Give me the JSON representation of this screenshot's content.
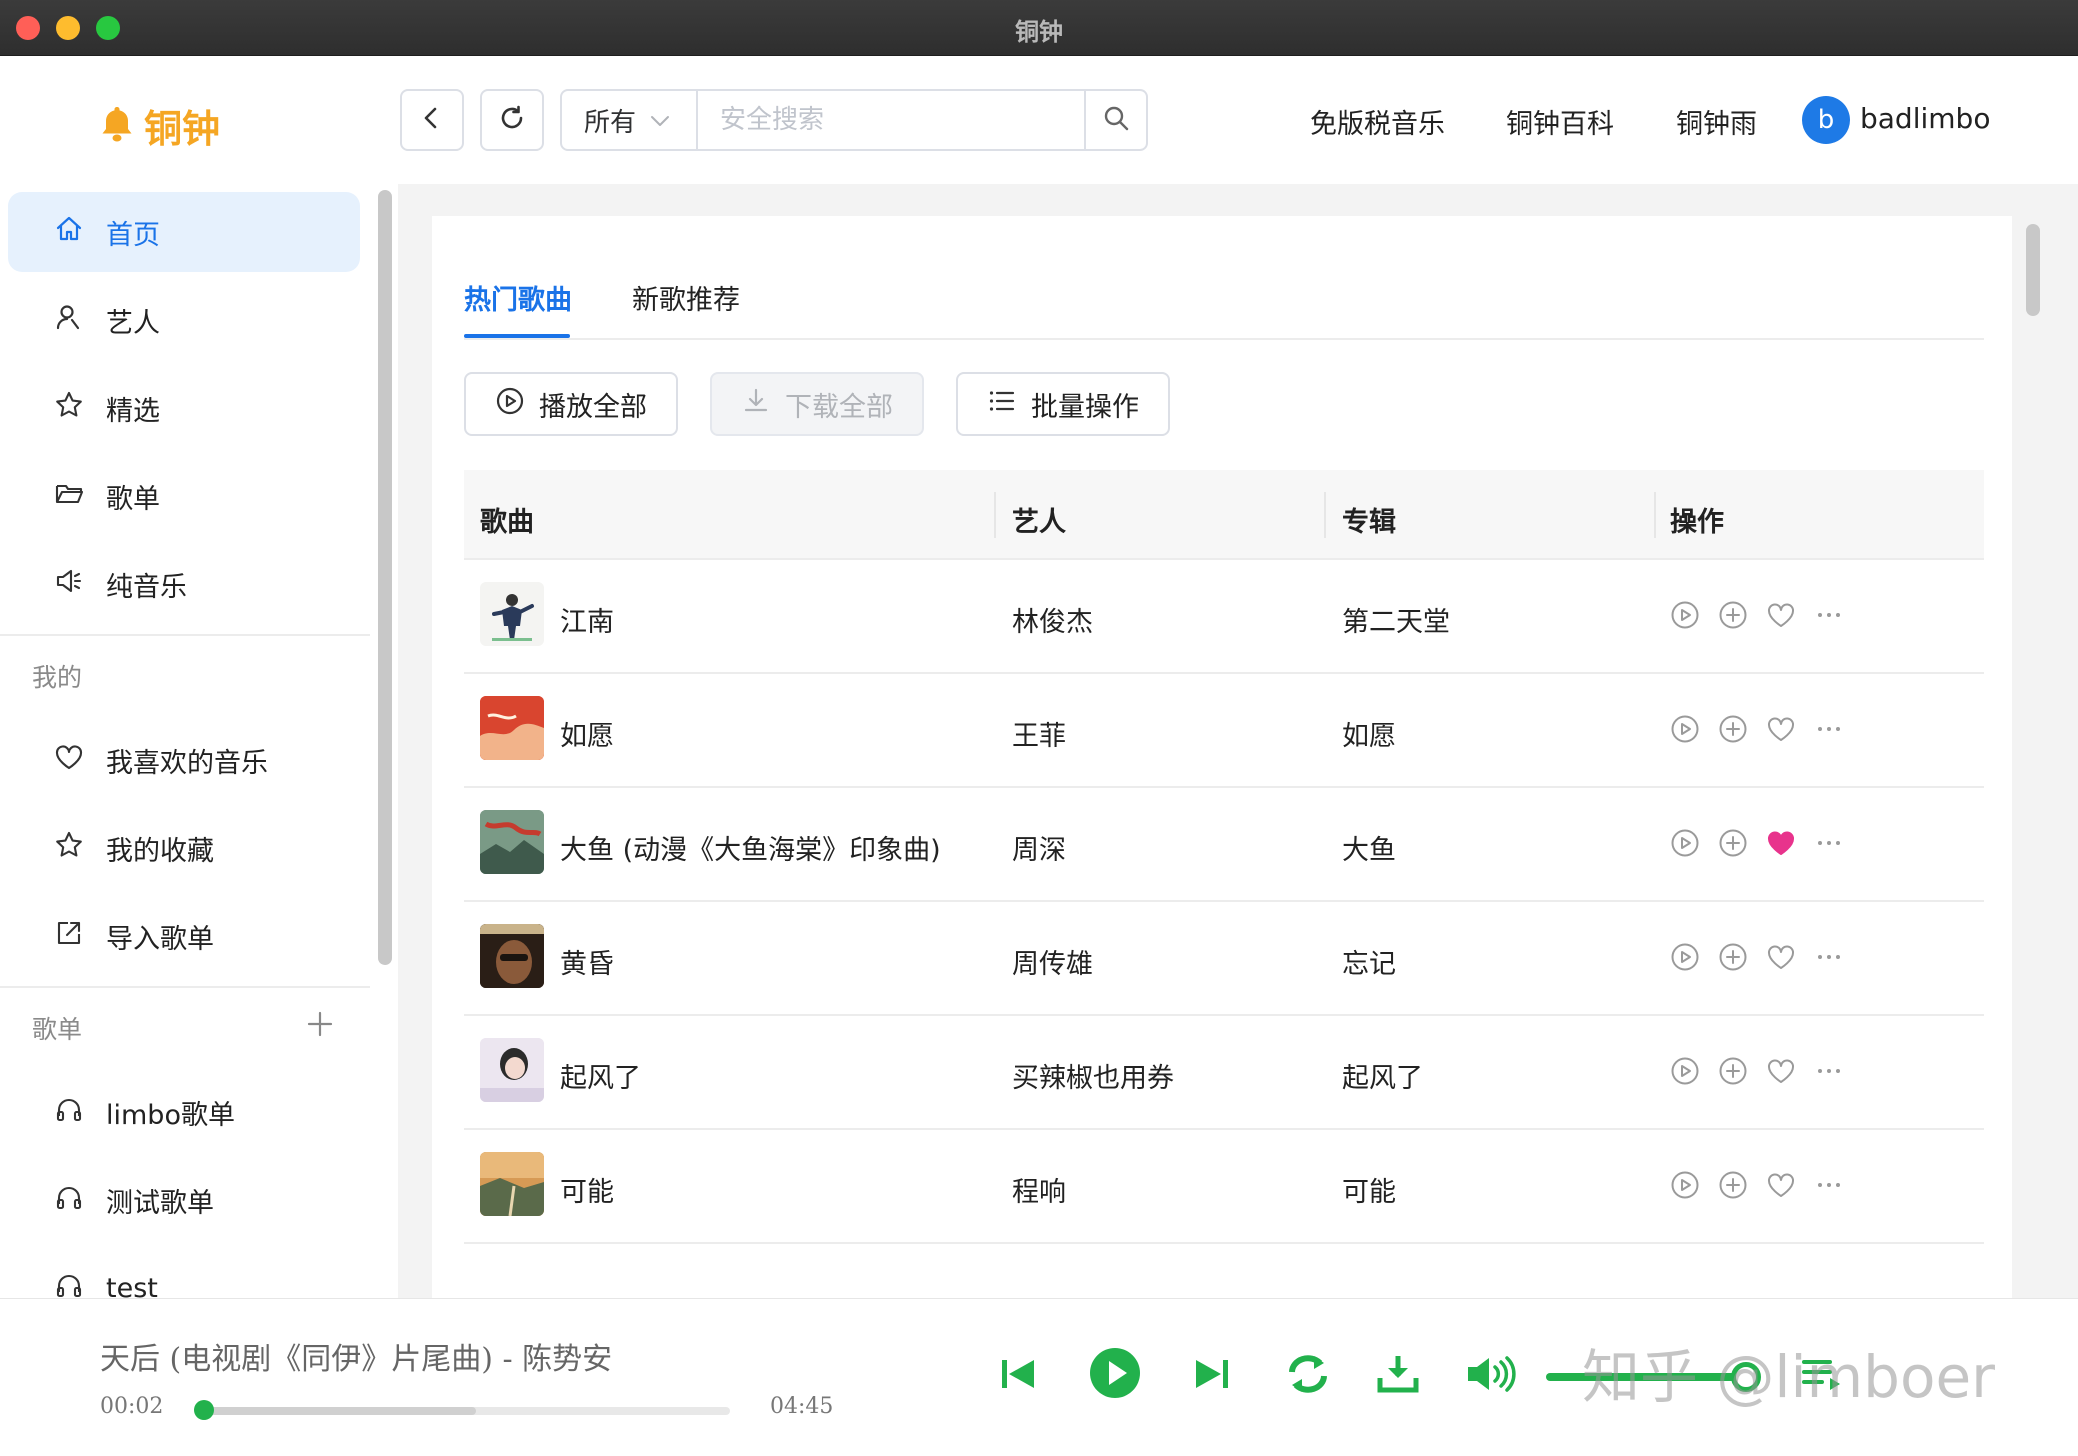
{
  "window": {
    "title": "铜钟"
  },
  "header": {
    "logo_text": "铜钟",
    "search": {
      "scope": "所有",
      "placeholder": "安全搜索"
    },
    "nav_links": [
      "免版税音乐",
      "铜钟百科",
      "铜钟雨"
    ],
    "user": {
      "avatar_letter": "b",
      "name": "badlimbo"
    }
  },
  "sidebar": {
    "main_items": [
      {
        "label": "首页",
        "icon": "home-icon",
        "active": true
      },
      {
        "label": "艺人",
        "icon": "artist-icon"
      },
      {
        "label": "精选",
        "icon": "star-icon"
      },
      {
        "label": "歌单",
        "icon": "folder-icon"
      },
      {
        "label": "纯音乐",
        "icon": "speaker-icon"
      }
    ],
    "mine_title": "我的",
    "mine_items": [
      {
        "label": "我喜欢的音乐",
        "icon": "heart-icon"
      },
      {
        "label": "我的收藏",
        "icon": "star-icon"
      },
      {
        "label": "导入歌单",
        "icon": "import-icon"
      }
    ],
    "playlists_title": "歌单",
    "playlists": [
      {
        "label": "limbo歌单",
        "icon": "headphones-icon"
      },
      {
        "label": "测试歌单",
        "icon": "headphones-icon"
      },
      {
        "label": "test",
        "icon": "headphones-icon"
      }
    ]
  },
  "main": {
    "tabs": [
      {
        "label": "热门歌曲",
        "active": true
      },
      {
        "label": "新歌推荐",
        "active": false
      }
    ],
    "actions": {
      "play_all": "播放全部",
      "download_all": "下载全部",
      "batch": "批量操作"
    },
    "table": {
      "columns": [
        "歌曲",
        "艺人",
        "专辑",
        "操作"
      ],
      "rows": [
        {
          "title": "江南",
          "artist": "林俊杰",
          "album": "第二天堂",
          "liked": false
        },
        {
          "title": "如愿",
          "artist": "王菲",
          "album": "如愿",
          "liked": false
        },
        {
          "title": "大鱼 (动漫《大鱼海棠》印象曲)",
          "artist": "周深",
          "album": "大鱼",
          "liked": true
        },
        {
          "title": "黄昏",
          "artist": "周传雄",
          "album": "忘记",
          "liked": false
        },
        {
          "title": "起风了",
          "artist": "买辣椒也用券",
          "album": "起风了",
          "liked": false
        },
        {
          "title": "可能",
          "artist": "程响",
          "album": "可能",
          "liked": false
        }
      ]
    }
  },
  "player": {
    "now_playing": "天后 (电视剧《同伊》片尾曲) - 陈势安",
    "current_time": "00:02",
    "total_time": "04:45",
    "progress_fraction": 0.007,
    "buffered_fraction": 0.52,
    "volume_fraction": 0.95
  },
  "watermark": "知乎 @limboer",
  "colors": {
    "accent_blue": "#1a73e8",
    "logo_orange": "#f5a623",
    "player_green": "#22b14c",
    "liked_pink": "#e8338c"
  }
}
